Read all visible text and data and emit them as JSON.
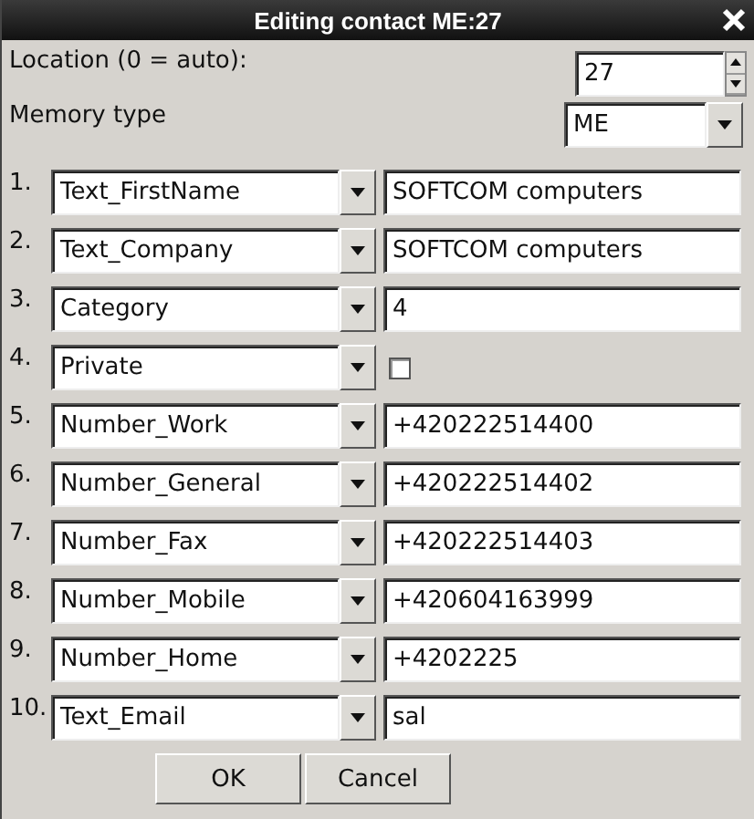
{
  "window": {
    "title": "Editing contact ME:27"
  },
  "location": {
    "label": "Location (0 = auto):",
    "value": "27"
  },
  "memory_type": {
    "label": "Memory type",
    "value": "ME"
  },
  "fields": [
    {
      "index": "1.",
      "type": "Text_FirstName",
      "kind": "text",
      "value": "SOFTCOM computers"
    },
    {
      "index": "2.",
      "type": "Text_Company",
      "kind": "text",
      "value": "SOFTCOM computers"
    },
    {
      "index": "3.",
      "type": "Category",
      "kind": "text",
      "value": "4"
    },
    {
      "index": "4.",
      "type": "Private",
      "kind": "checkbox",
      "checked": false
    },
    {
      "index": "5.",
      "type": "Number_Work",
      "kind": "text",
      "value": "+420222514400"
    },
    {
      "index": "6.",
      "type": "Number_General",
      "kind": "text",
      "value": "+420222514402"
    },
    {
      "index": "7.",
      "type": "Number_Fax",
      "kind": "text",
      "value": "+420222514403"
    },
    {
      "index": "8.",
      "type": "Number_Mobile",
      "kind": "text",
      "value": "+420604163999"
    },
    {
      "index": "9.",
      "type": "Number_Home",
      "kind": "text",
      "value": "+4202225"
    },
    {
      "index": "10.",
      "type": "Text_Email",
      "kind": "text",
      "value": "sal"
    }
  ],
  "buttons": [
    "OK",
    "Cancel"
  ]
}
